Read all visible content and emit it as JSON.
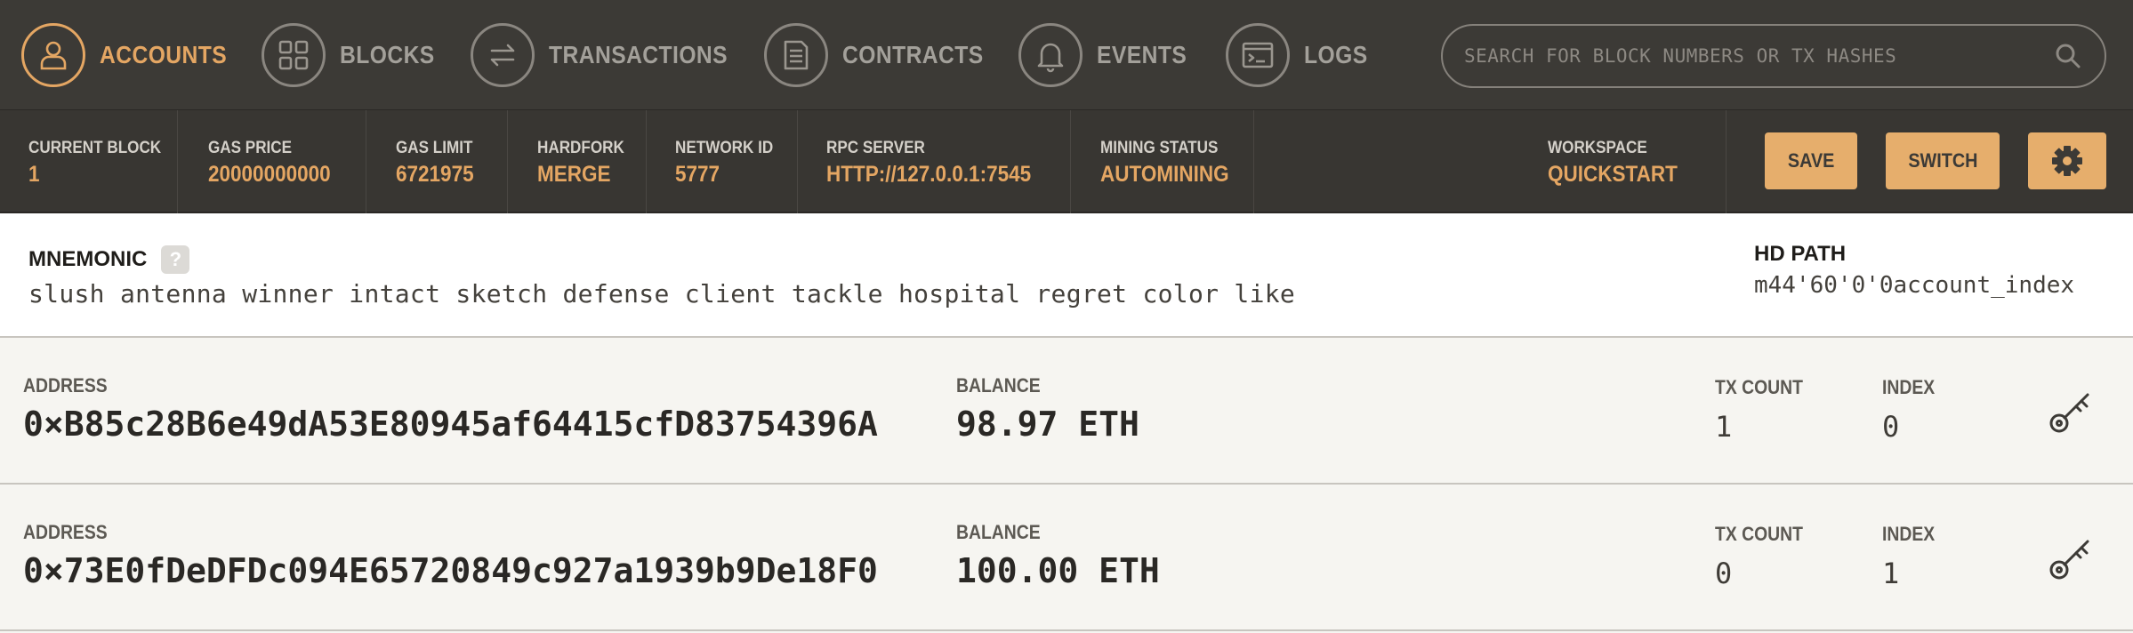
{
  "nav": {
    "items": [
      {
        "label": "ACCOUNTS",
        "icon": "user-icon",
        "active": true
      },
      {
        "label": "BLOCKS",
        "icon": "blocks-icon",
        "active": false
      },
      {
        "label": "TRANSACTIONS",
        "icon": "transfer-arrows-icon",
        "active": false
      },
      {
        "label": "CONTRACTS",
        "icon": "document-icon",
        "active": false
      },
      {
        "label": "EVENTS",
        "icon": "bell-icon",
        "active": false
      },
      {
        "label": "LOGS",
        "icon": "terminal-icon",
        "active": false
      }
    ],
    "search_placeholder": "SEARCH FOR BLOCK NUMBERS OR TX HASHES"
  },
  "status": {
    "current_block": {
      "label": "CURRENT BLOCK",
      "value": "1"
    },
    "gas_price": {
      "label": "GAS PRICE",
      "value": "20000000000"
    },
    "gas_limit": {
      "label": "GAS LIMIT",
      "value": "6721975"
    },
    "hardfork": {
      "label": "HARDFORK",
      "value": "MERGE"
    },
    "network_id": {
      "label": "NETWORK ID",
      "value": "5777"
    },
    "rpc_server": {
      "label": "RPC SERVER",
      "value": "HTTP://127.0.0.1:7545"
    },
    "mining_status": {
      "label": "MINING STATUS",
      "value": "AUTOMINING"
    },
    "workspace": {
      "label": "WORKSPACE",
      "value": "QUICKSTART"
    },
    "save_label": "SAVE",
    "switch_label": "SWITCH"
  },
  "mnemonic": {
    "title": "MNEMONIC",
    "help": "?",
    "words": "slush antenna winner intact sketch defense client tackle hospital regret color like",
    "hd_path_label": "HD PATH",
    "hd_path": "m44'60'0'0account_index"
  },
  "accounts": [
    {
      "address_label": "ADDRESS",
      "address": "0×B85c28B6e49dA53E80945af64415cfD83754396A",
      "balance_label": "BALANCE",
      "balance": "98.97 ETH",
      "tx_count_label": "TX COUNT",
      "tx_count": "1",
      "index_label": "INDEX",
      "index": "0"
    },
    {
      "address_label": "ADDRESS",
      "address": "0×73E0fDeDFDc094E65720849c927a1939b9De18F0",
      "balance_label": "BALANCE",
      "balance": "100.00 ETH",
      "tx_count_label": "TX COUNT",
      "tx_count": "0",
      "index_label": "INDEX",
      "index": "1"
    }
  ],
  "colors": {
    "accent": "#e4a663",
    "nav_bg": "#3c3a36",
    "status_bg": "#383632",
    "row_bg": "#f6f5f1"
  }
}
